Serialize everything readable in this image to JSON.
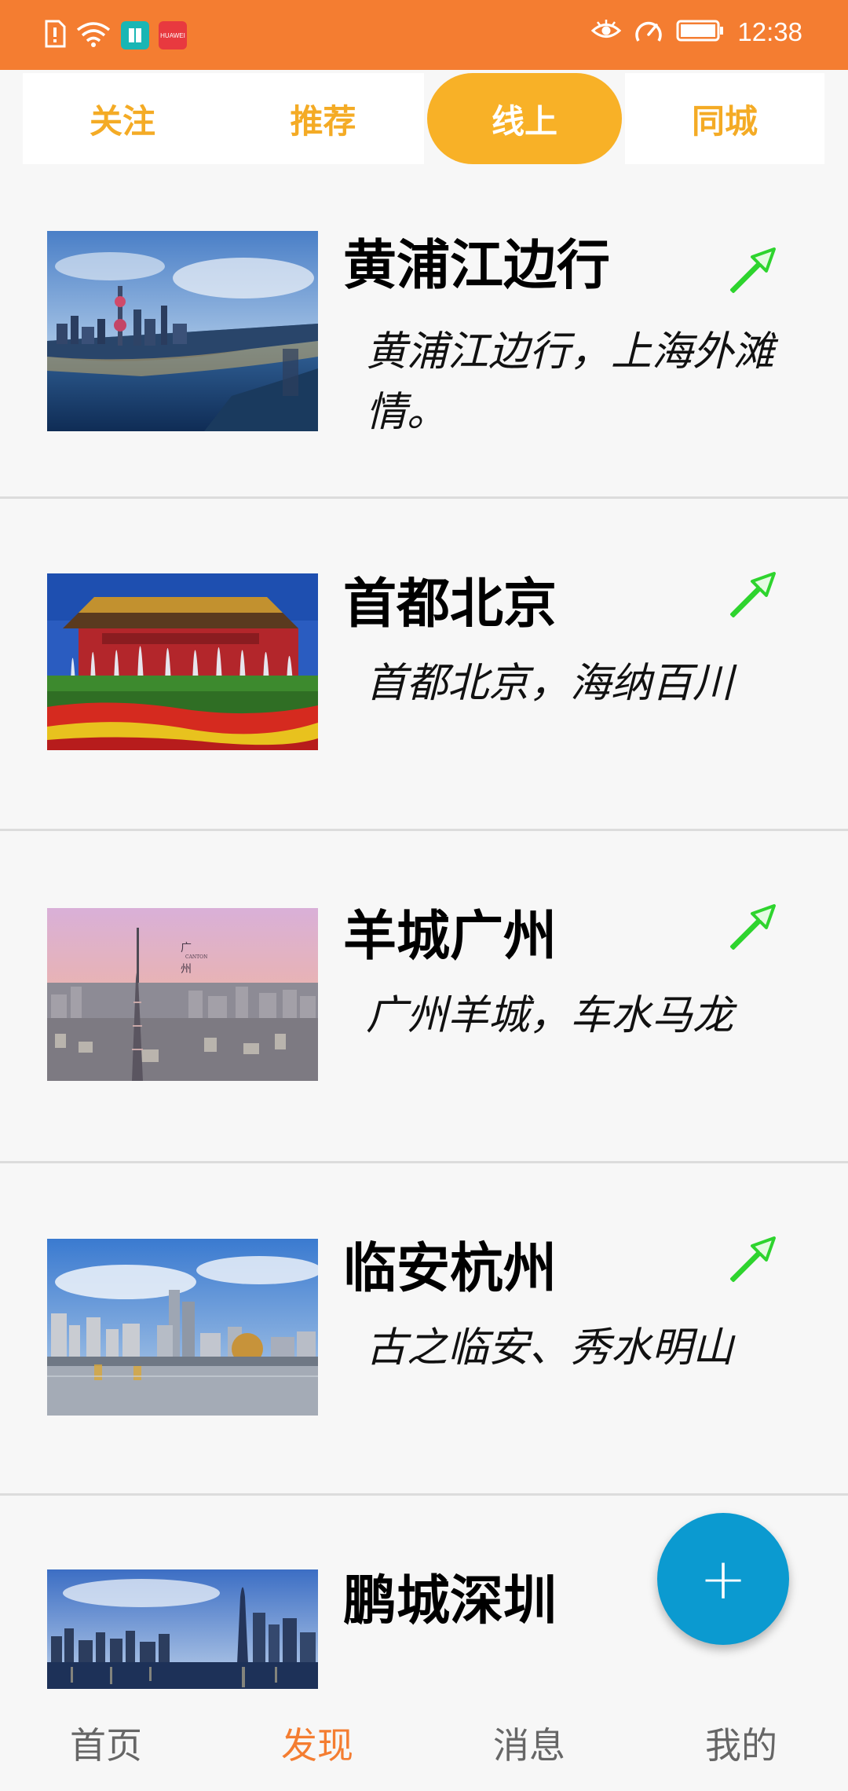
{
  "status_bar": {
    "time": "12:38",
    "left_icons": [
      "notification-alert-icon",
      "wifi-icon",
      "book-app-icon",
      "huawei-appgallery-icon"
    ],
    "right_icons": [
      "eye-comfort-icon",
      "speed-gauge-icon",
      "battery-icon"
    ],
    "huawei_label": "HUAWEI"
  },
  "tabs": [
    {
      "label": "关注",
      "active": false
    },
    {
      "label": "推荐",
      "active": false
    },
    {
      "label": "线上",
      "active": true
    },
    {
      "label": "同城",
      "active": false
    }
  ],
  "feed": [
    {
      "title": "黄浦江边行",
      "description": "黄浦江边行，上海外滩情。"
    },
    {
      "title": "首都北京",
      "description": "首都北京，海纳百川"
    },
    {
      "title": "羊城广州",
      "description": "广州羊城，车水马龙",
      "image_caption": "广\nCANTON\n州"
    },
    {
      "title": "临安杭州",
      "description": "古之临安、秀水明山"
    },
    {
      "title": "鹏城深圳",
      "description": ""
    }
  ],
  "fab": {
    "label": "+"
  },
  "bottom_nav": [
    {
      "label": "首页",
      "active": false
    },
    {
      "label": "发现",
      "active": true
    },
    {
      "label": "消息",
      "active": false
    },
    {
      "label": "我的",
      "active": false
    }
  ],
  "colors": {
    "status_bar": "#f47d31",
    "tab_text": "#f4ab25",
    "tab_active_bg": "#f8b127",
    "fab": "#0b9ad0",
    "nav_active": "#f47d31",
    "share_icon": "#2ed42e"
  }
}
